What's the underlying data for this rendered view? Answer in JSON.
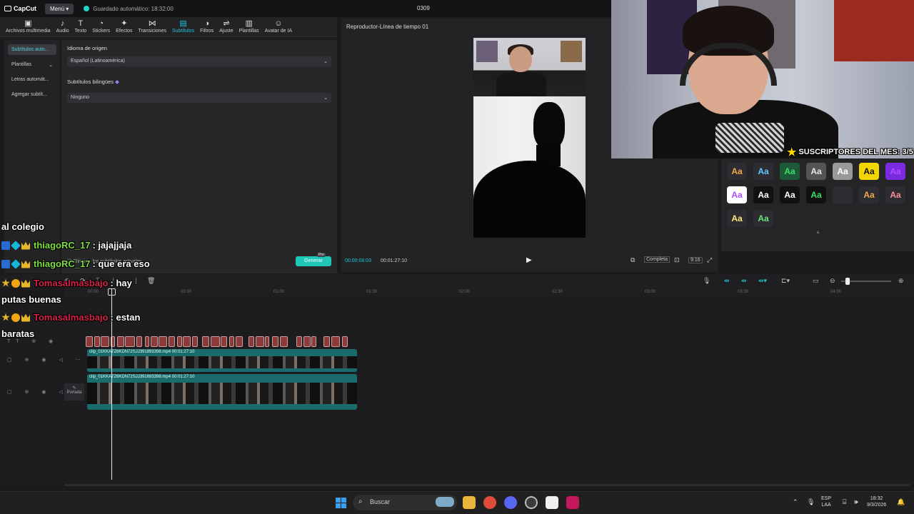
{
  "titlebar": {
    "app_name": "CapCut",
    "menu_label": "Menú",
    "autosave_text": "Guardado automático: 18:32:00",
    "project_name": "0309"
  },
  "toolbar": {
    "tools": [
      {
        "label": "Archivos multimedia",
        "icon": "media-icon",
        "glyph": "▣"
      },
      {
        "label": "Audio",
        "icon": "audio-icon",
        "glyph": "♪"
      },
      {
        "label": "Texto",
        "icon": "text-icon",
        "glyph": "T"
      },
      {
        "label": "Stickers",
        "icon": "sticker-icon",
        "glyph": "◔"
      },
      {
        "label": "Efectos",
        "icon": "effects-icon",
        "glyph": "✦"
      },
      {
        "label": "Transiciones",
        "icon": "transition-icon",
        "glyph": "⋈"
      },
      {
        "label": "Subtítulos",
        "icon": "subtitles-icon",
        "glyph": "▤"
      },
      {
        "label": "Filtros",
        "icon": "filter-icon",
        "glyph": "◑"
      },
      {
        "label": "Ajuste",
        "icon": "adjust-icon",
        "glyph": "⇌"
      },
      {
        "label": "Plantillas",
        "icon": "templates-icon",
        "glyph": "▥"
      },
      {
        "label": "Avatar de IA",
        "icon": "ai-avatar-icon",
        "glyph": "☺"
      }
    ],
    "active_index": 6
  },
  "subtitles_panel": {
    "nav": [
      {
        "label": "Subtítulos auto...",
        "active": true
      },
      {
        "label": "Plantillas",
        "active": false,
        "has_chevron": true
      },
      {
        "label": "Letras automát...",
        "active": false
      },
      {
        "label": "Agregar subtít...",
        "active": false
      }
    ],
    "source_language_label": "Idioma de origen",
    "source_language_value": "Español (Latinoamérica)",
    "bilingual_label": "Subtítulos bilingües",
    "bilingual_value": "Ninguno",
    "clear_label": "Eliminar los subtítulos actuales",
    "generate_label": "Generar",
    "pro_badge": "Pro"
  },
  "player": {
    "title": "Reproductor-Línea de tiempo 01",
    "current_time": "00:00:08:03",
    "total_time": "00:01:27:10",
    "full_label": "Completa",
    "ratio_label": "9:16"
  },
  "text_styles": {
    "samples": [
      "Aa",
      "Aa",
      "Aa",
      "Aa",
      "Aa",
      "Aa",
      "Aa",
      "Aa",
      "Aa",
      "Aa",
      "Aa",
      "Aa",
      "Aa",
      "Aa",
      "Aa",
      "Aa"
    ],
    "colors": [
      "#f0a94a",
      "#5ec8ff",
      "#3be06a",
      "#e6e6e6",
      "#ffffff",
      "#111111",
      "#b14cff",
      "#b14cff",
      "#ffffff",
      "#ffffff",
      "#3be06a",
      "#2e2e2e",
      "#f0a94a",
      "#ff8ca0",
      "#ffe97a",
      "#6ee07a"
    ],
    "backgrounds": [
      "#2d2d31",
      "#2d2d31",
      "#1e5a3a",
      "#555555",
      "#9a9a9a",
      "#f2d600",
      "#7a2be0",
      "#ffffff",
      "#111111",
      "#111111",
      "#111111",
      "#2d2d31",
      "#2d2d31",
      "#2d2d31",
      "#2d2d31",
      "#2d2d31"
    ]
  },
  "webcam": {
    "banner": "SUSCRIPTORES DEL MES: 3/5"
  },
  "chat": [
    {
      "user": "",
      "text": "al colegio",
      "badges": []
    },
    {
      "user": "thiagoRC_17",
      "text": ": jajajjaja",
      "badges": [
        "blue",
        "cyan",
        "crown"
      ]
    },
    {
      "user": "thiagoRC_17",
      "text": ": que era eso",
      "badges": [
        "blue",
        "cyan",
        "crown"
      ]
    },
    {
      "user": "Tomasalmasbajo",
      "text": ": hay",
      "badges": [
        "star",
        "coin",
        "crown"
      ]
    },
    {
      "user": "",
      "text": "putas buenas",
      "badges": []
    },
    {
      "user": "Tomasalmasbajo",
      "text": ": estan",
      "badges": [
        "star",
        "coin",
        "crown"
      ]
    },
    {
      "user": "",
      "text": "baratas",
      "badges": []
    }
  ],
  "timeline": {
    "ruler_ticks": [
      "00:00",
      "00:30",
      "01:00",
      "01:30",
      "02:00",
      "02:30",
      "03:00",
      "03:30",
      "04:00"
    ],
    "clip_top_label": "clip_01KKA7Z6KDN72SJJ391893398.mp4  00:01:27:10",
    "clip_bottom_label": "clip_01KKA7Z6KDN72SJJ391893398.mp4  00:01:27:10",
    "cover_label": "Portada",
    "subtitle_clip_count": 30
  },
  "taskbar": {
    "search_placeholder": "Buscar",
    "lang_top": "ESP",
    "lang_bottom": "LAA",
    "time": "18:32",
    "date": "9/3/2026"
  }
}
